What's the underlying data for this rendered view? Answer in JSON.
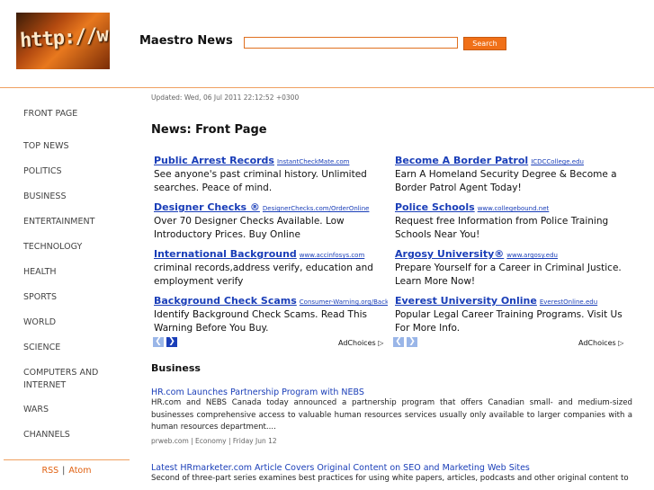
{
  "header": {
    "logo_text": "http://w",
    "title": "Maestro News",
    "search_placeholder": "",
    "search_button": "Search"
  },
  "nav": {
    "items": [
      "FRONT PAGE",
      "TOP NEWS",
      "POLITICS",
      "BUSINESS",
      "ENTERTAINMENT",
      "TECHNOLOGY",
      "HEALTH",
      "SPORTS",
      "WORLD",
      "SCIENCE",
      "COMPUTERS AND INTERNET",
      "WARS",
      "CHANNELS"
    ],
    "rss": "RSS",
    "separator": "|",
    "atom": "Atom"
  },
  "main": {
    "updated": "Updated: Wed, 06 Jul 2011 22:12:52 +0300",
    "heading": "News: Front Page"
  },
  "ads": {
    "left": [
      {
        "title": "Public Arrest Records",
        "url": "InstantCheckMate.com",
        "desc": "See anyone's past criminal history. Unlimited searches. Peace of mind."
      },
      {
        "title": "Designer Checks ®",
        "url": "DesignerChecks.com/OrderOnline",
        "desc": "Over 70 Designer Checks Available. Low Introductory Prices. Buy Online"
      },
      {
        "title": "International Background",
        "url": "www.accinfosys.com",
        "desc": "criminal records,address verify, education and employment verify"
      },
      {
        "title": "Background Check Scams",
        "url": "Consumer-Warning.org/Backgro",
        "desc": "Identify Background Check Scams. Read This Warning Before You Buy."
      }
    ],
    "right": [
      {
        "title": "Become A Border Patrol",
        "url": "ICDCCollege.edu",
        "desc": "Earn A Homeland Security Degree & Become a Border Patrol Agent Today!"
      },
      {
        "title": "Police Schools",
        "url": "www.collegebound.net",
        "desc": "Request free Information from Police Training Schools Near You!"
      },
      {
        "title": "Argosy University®",
        "url": "www.argosy.edu",
        "desc": "Prepare Yourself for a Career in Criminal Justice. Learn More Now!"
      },
      {
        "title": "Everest University Online",
        "url": "EverestOnline.edu",
        "desc": "Popular Legal Career Training Programs. Visit Us For More Info."
      }
    ],
    "adchoices": "AdChoices",
    "prev": "❮",
    "next": "❯"
  },
  "business": {
    "title": "Business",
    "articles": [
      {
        "title": "HR.com Launches Partnership Program with NEBS",
        "body": "HR.com and NEBS Canada today announced a partnership program that offers Canadian small- and medium-sized businesses comprehensive access to valuable human resources services usually only available to larger companies with a human resources department....",
        "meta": "prweb.com | Economy | Friday Jun 12"
      },
      {
        "title": "Latest HRmarketer.com Article Covers Original Content on SEO and Marketing Web Sites",
        "body": "Second of three-part series examines best practices for using white papers, articles, podcasts and other original content to"
      }
    ]
  },
  "colors": {
    "accent": "#f07018",
    "link": "#1a3eb8"
  }
}
